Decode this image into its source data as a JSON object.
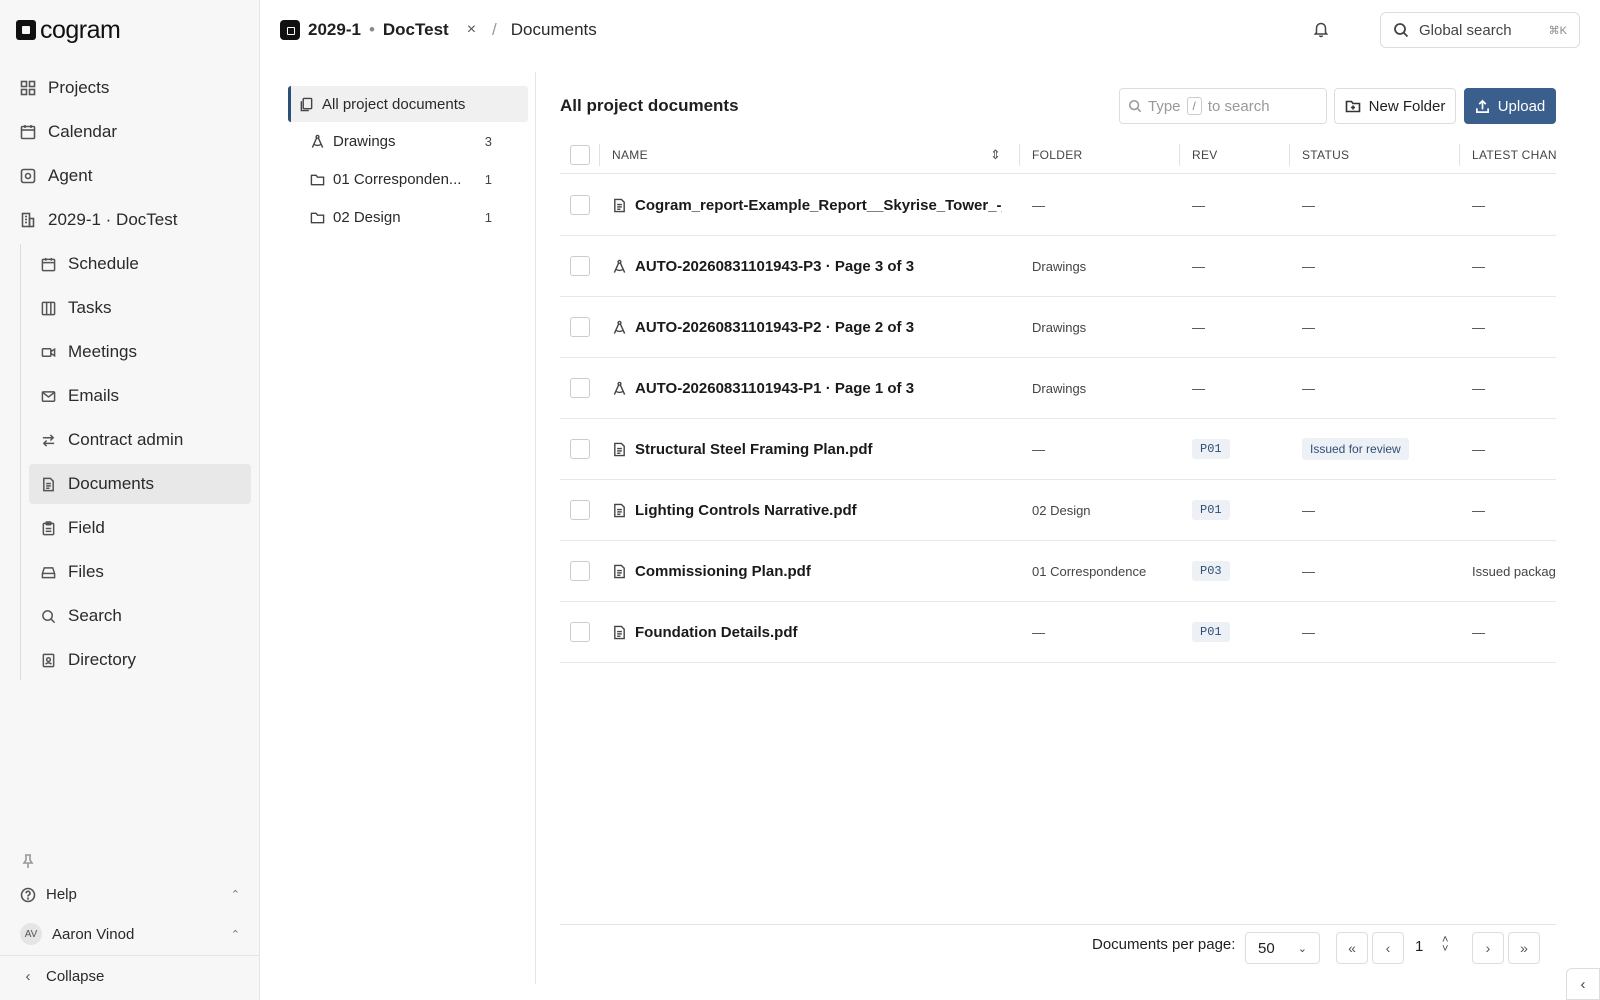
{
  "brand": {
    "name": "cogram"
  },
  "nav": {
    "projects": "Projects",
    "calendar": "Calendar",
    "agent": "Agent",
    "project": "2029-1 · DocTest",
    "sub": [
      "Schedule",
      "Tasks",
      "Meetings",
      "Emails",
      "Contract admin",
      "Documents",
      "Field",
      "Files",
      "Search",
      "Directory"
    ]
  },
  "bottom": {
    "help": "Help",
    "user": "Aaron Vinod",
    "initials": "AV",
    "collapse": "Collapse"
  },
  "topbar": {
    "project_code": "2029-1",
    "separator": "•",
    "project_name": "DocTest",
    "close": "×",
    "crumb_sep": "/",
    "crumb": "Documents",
    "global_search": "Global search",
    "shortcut": "⌘K"
  },
  "tree": {
    "items": [
      {
        "label": "All project documents",
        "count": ""
      },
      {
        "label": "Drawings",
        "count": "3"
      },
      {
        "label": "01 Corresponden...",
        "count": "1"
      },
      {
        "label": "02 Design",
        "count": "1"
      }
    ]
  },
  "main": {
    "title": "All project documents",
    "search_type": "Type",
    "search_key": "/",
    "search_rest": "to search",
    "new_folder": "New Folder",
    "upload": "Upload"
  },
  "table": {
    "columns": [
      "Name",
      "Folder",
      "Rev",
      "Status",
      "Latest chan"
    ],
    "rows": [
      {
        "name": "Cogram_report-Example_Report__Skyrise_Tower_-_...",
        "folder": "—",
        "rev": "—",
        "status": "—",
        "latest": "—",
        "icon": "document-icon"
      },
      {
        "name": "AUTO-20260831101943-P3 · Page 3 of 3",
        "folder": "Drawings",
        "rev": "—",
        "status": "—",
        "latest": "—",
        "icon": "drawing-icon"
      },
      {
        "name": "AUTO-20260831101943-P2 · Page 2 of 3",
        "folder": "Drawings",
        "rev": "—",
        "status": "—",
        "latest": "—",
        "icon": "drawing-icon"
      },
      {
        "name": "AUTO-20260831101943-P1 · Page 1 of 3",
        "folder": "Drawings",
        "rev": "—",
        "status": "—",
        "latest": "—",
        "icon": "drawing-icon"
      },
      {
        "name": "Structural Steel Framing Plan.pdf",
        "folder": "—",
        "rev": "P01",
        "status": "Issued for review",
        "latest": "—",
        "icon": "document-icon"
      },
      {
        "name": "Lighting Controls Narrative.pdf",
        "folder": "02 Design",
        "rev": "P01",
        "status": "—",
        "latest": "—",
        "icon": "document-icon"
      },
      {
        "name": "Commissioning Plan.pdf",
        "folder": "01 Correspondence",
        "rev": "P03",
        "status": "—",
        "latest": "Issued package",
        "icon": "document-icon"
      },
      {
        "name": "Foundation Details.pdf",
        "folder": "—",
        "rev": "P01",
        "status": "—",
        "latest": "—",
        "icon": "document-icon"
      }
    ]
  },
  "pagination": {
    "per_page_label": "Documents per page:",
    "per_page": "50",
    "page": "1"
  },
  "colors": {
    "accent": "#3b5f8c",
    "badge_bg": "#edf1f6",
    "badge_fg": "#2f4e76",
    "sidebar_bg": "#f7f7f7"
  }
}
